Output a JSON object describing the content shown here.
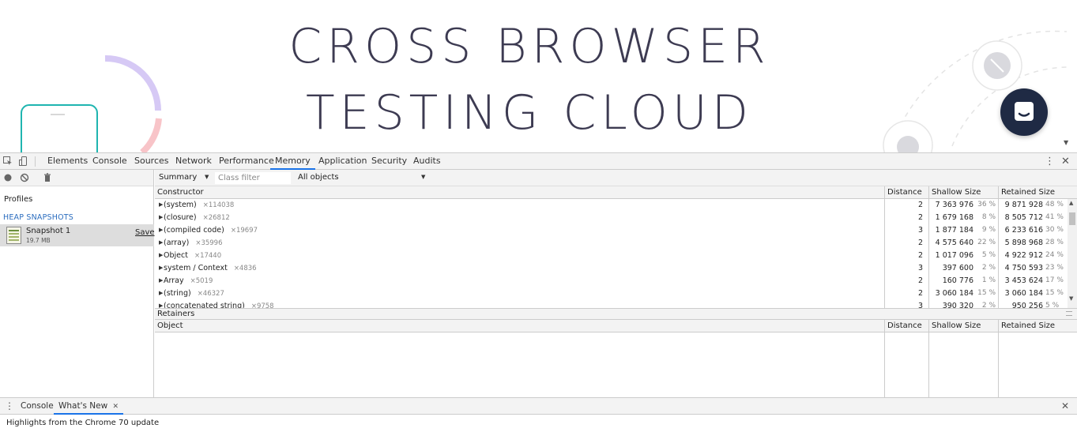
{
  "webpage": {
    "hero_line1": "CROSS BROWSER",
    "hero_line2": "TESTING CLOUD",
    "colors": {
      "hero_text": "#3d3b52",
      "chat_button": "#1f2a44",
      "phone_outline": "#1fb5b0",
      "arc_purple": "#d6c9f5",
      "arc_pink": "#f8c4c8"
    }
  },
  "devtools": {
    "tabs": [
      "Elements",
      "Console",
      "Sources",
      "Network",
      "Performance",
      "Memory",
      "Application",
      "Security",
      "Audits"
    ],
    "active_tab": "Memory",
    "left_panel": {
      "profiles_label": "Profiles",
      "heap_snapshots_title": "HEAP SNAPSHOTS",
      "snapshot": {
        "name": "Snapshot 1",
        "size": "19.7 MB",
        "save_label": "Save"
      }
    },
    "toolbar": {
      "view_select": "Summary",
      "class_filter_placeholder": "Class filter",
      "objects_select": "All objects"
    },
    "constructor_grid": {
      "headers": [
        "Constructor",
        "Distance",
        "Shallow Size",
        "Retained Size"
      ],
      "rows": [
        {
          "name": "(system)",
          "count": "×114038",
          "distance": "2",
          "shallow": "7 363 976",
          "shallow_pct": "36 %",
          "retained": "9 871 928",
          "retained_pct": "48 %"
        },
        {
          "name": "(closure)",
          "count": "×26812",
          "distance": "2",
          "shallow": "1 679 168",
          "shallow_pct": "8 %",
          "retained": "8 505 712",
          "retained_pct": "41 %"
        },
        {
          "name": "(compiled code)",
          "count": "×19697",
          "distance": "3",
          "shallow": "1 877 184",
          "shallow_pct": "9 %",
          "retained": "6 233 616",
          "retained_pct": "30 %"
        },
        {
          "name": "(array)",
          "count": "×35996",
          "distance": "2",
          "shallow": "4 575 640",
          "shallow_pct": "22 %",
          "retained": "5 898 968",
          "retained_pct": "28 %"
        },
        {
          "name": "Object",
          "count": "×17440",
          "distance": "2",
          "shallow": "1 017 096",
          "shallow_pct": "5 %",
          "retained": "4 922 912",
          "retained_pct": "24 %"
        },
        {
          "name": "system / Context",
          "count": "×4836",
          "distance": "3",
          "shallow": "397 600",
          "shallow_pct": "2 %",
          "retained": "4 750 593",
          "retained_pct": "23 %"
        },
        {
          "name": "Array",
          "count": "×5019",
          "distance": "2",
          "shallow": "160 776",
          "shallow_pct": "1 %",
          "retained": "3 453 624",
          "retained_pct": "17 %"
        },
        {
          "name": "(string)",
          "count": "×46327",
          "distance": "2",
          "shallow": "3 060 184",
          "shallow_pct": "15 %",
          "retained": "3 060 184",
          "retained_pct": "15 %"
        },
        {
          "name": "(concatenated string)",
          "count": "×9758",
          "distance": "3",
          "shallow": "390 320",
          "shallow_pct": "2 %",
          "retained": "950 256",
          "retained_pct": "5 %"
        }
      ]
    },
    "retainers": {
      "label": "Retainers",
      "headers": [
        "Object",
        "Distance",
        "Shallow Size",
        "Retained Size"
      ]
    }
  },
  "drawer": {
    "tabs": [
      "Console",
      "What's New"
    ],
    "active_tab": "What's New",
    "content_text": "Highlights from the Chrome 70 update"
  }
}
